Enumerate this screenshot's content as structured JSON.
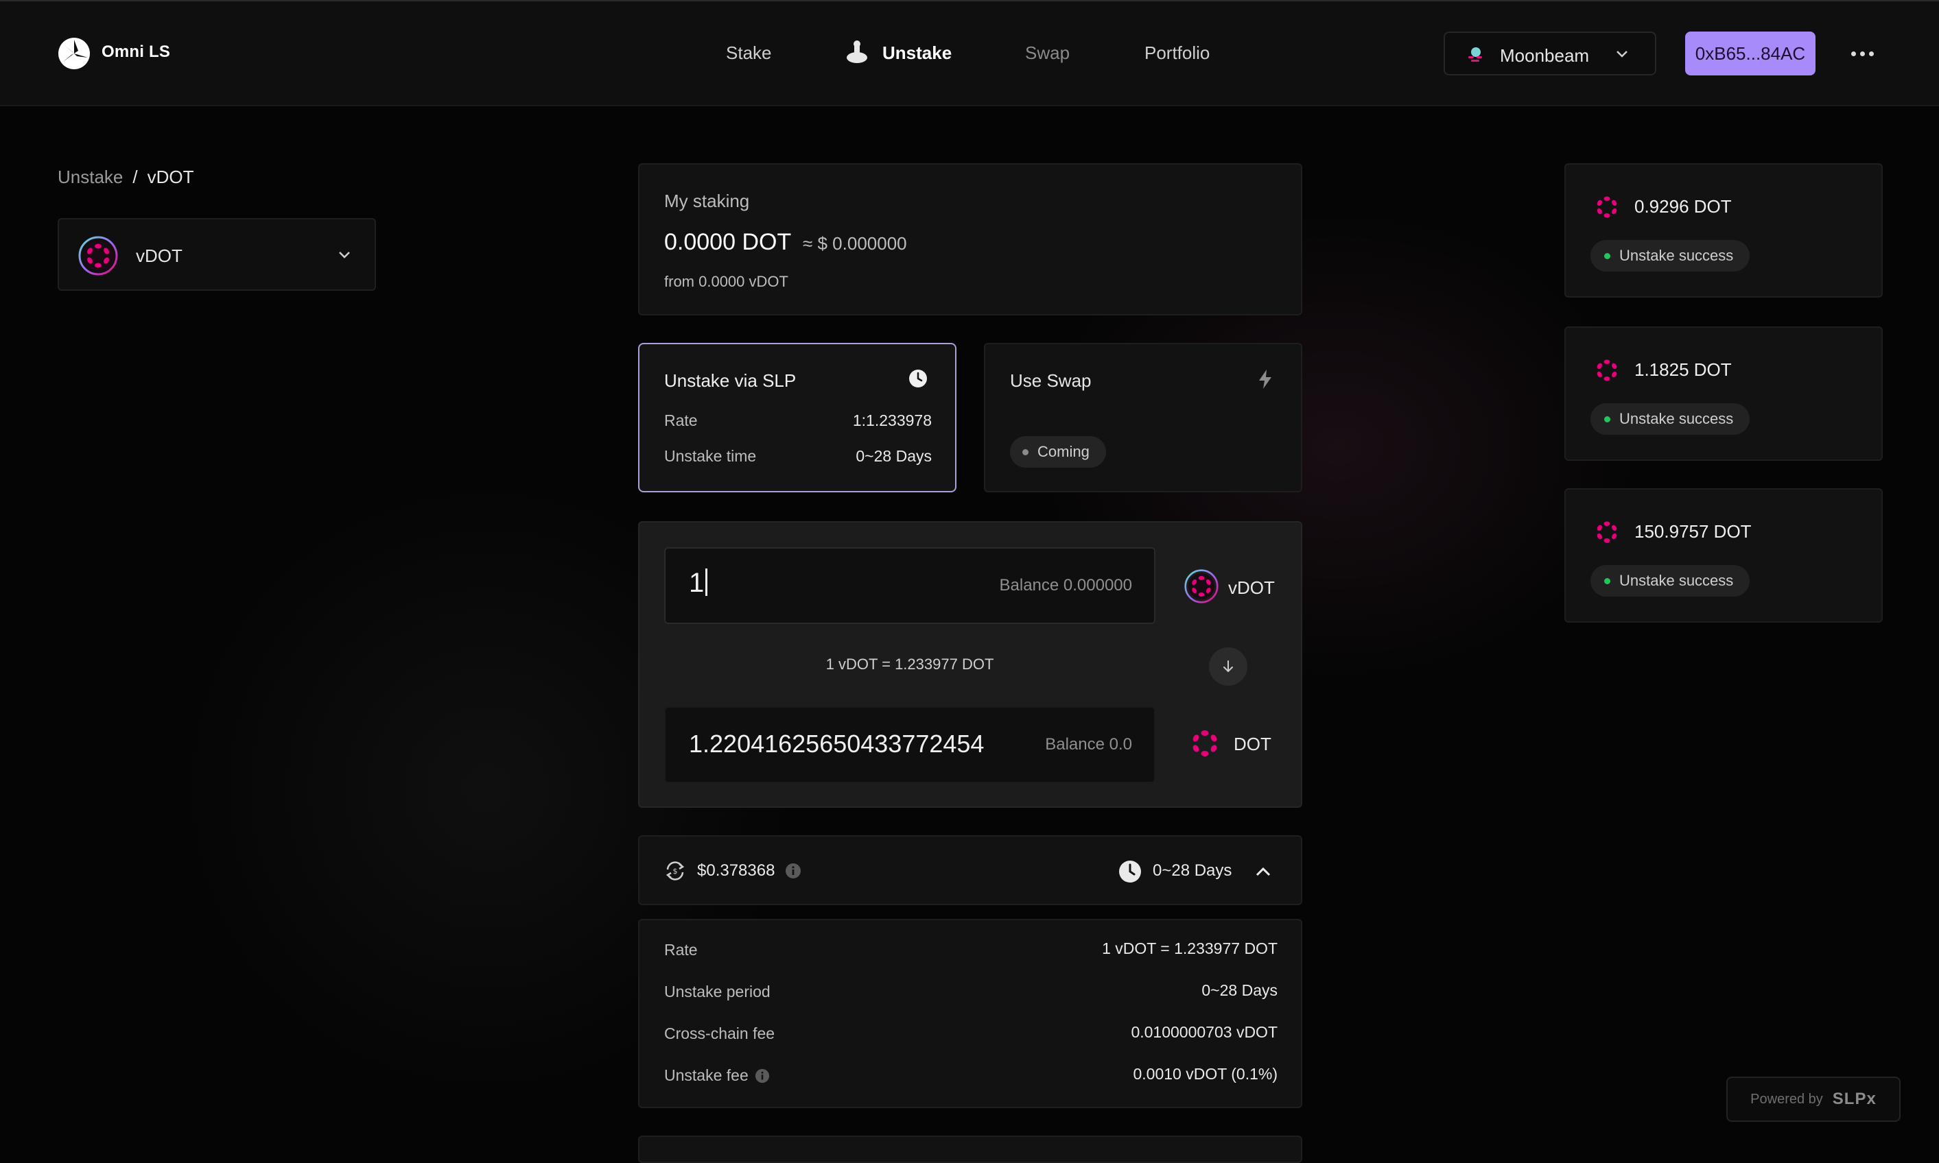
{
  "header": {
    "brand": "Omni LS",
    "nav": [
      {
        "label": "Stake"
      },
      {
        "label": "Unstake"
      },
      {
        "label": "Swap"
      },
      {
        "label": "Portfolio"
      }
    ],
    "network": "Moonbeam",
    "wallet": "0xB65...84AC"
  },
  "breadcrumb": {
    "parent": "Unstake",
    "separator": "/",
    "current": "vDOT"
  },
  "token_selector": {
    "label": "vDOT"
  },
  "my_staking": {
    "title": "My staking",
    "amount": "0.0000 DOT",
    "usd": "≈ $ 0.000000",
    "from": "from 0.0000 vDOT"
  },
  "methods": {
    "slp": {
      "title": "Unstake via SLP",
      "rate_label": "Rate",
      "rate_value": "1:1.233978",
      "time_label": "Unstake time",
      "time_value": "0~28 Days"
    },
    "swap": {
      "title": "Use Swap",
      "badge": "Coming"
    }
  },
  "convert": {
    "input_value": "1",
    "input_balance": "Balance 0.000000",
    "input_token": "vDOT",
    "rate": "1 vDOT = 1.233977 DOT",
    "output_value": "1.22041625650433772454",
    "output_balance": "Balance 0.0",
    "output_token": "DOT"
  },
  "summary": {
    "usd": "$0.378368",
    "period": "0~28 Days"
  },
  "details": [
    {
      "label": "Rate",
      "value": "1 vDOT = 1.233977 DOT"
    },
    {
      "label": "Unstake period",
      "value": "0~28 Days"
    },
    {
      "label": "Cross-chain fee",
      "value": "0.0100000703 vDOT"
    },
    {
      "label": "Unstake fee",
      "value": "0.0010 vDOT (0.1%)"
    }
  ],
  "history": [
    {
      "amount": "0.9296 DOT",
      "status": "Unstake success"
    },
    {
      "amount": "1.1825 DOT",
      "status": "Unstake success"
    },
    {
      "amount": "150.9757 DOT",
      "status": "Unstake success"
    }
  ],
  "footer": {
    "powered_by": "Powered by",
    "brand": "SLPx"
  },
  "colors": {
    "accent": "#a78bfa",
    "dot_pink": "#e6007a",
    "success": "#22c55e",
    "border_active": "#a7a2d8"
  }
}
